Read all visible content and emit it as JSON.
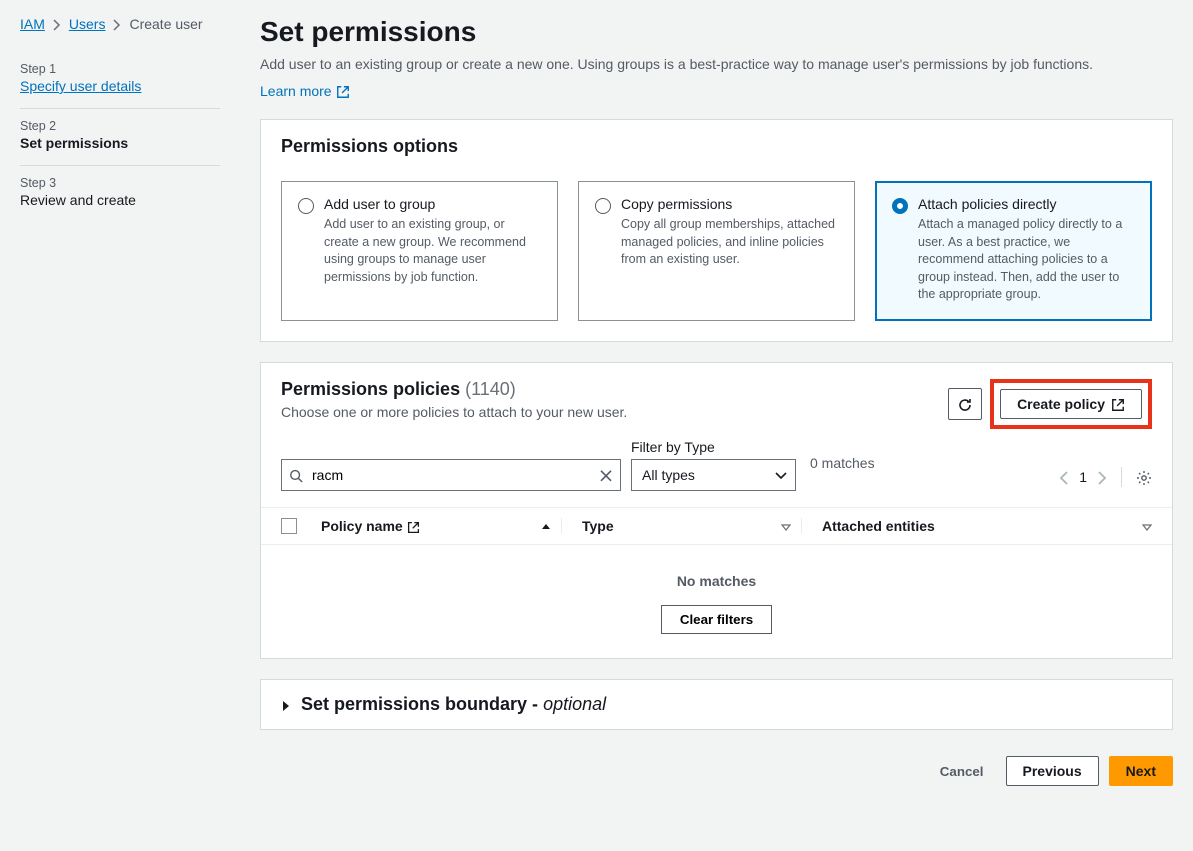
{
  "breadcrumb": {
    "items": [
      "IAM",
      "Users",
      "Create user"
    ]
  },
  "steps": {
    "step1_num": "Step 1",
    "step1_title": "Specify user details",
    "step2_num": "Step 2",
    "step2_title": "Set permissions",
    "step3_num": "Step 3",
    "step3_title": "Review and create"
  },
  "header": {
    "title": "Set permissions",
    "description": "Add user to an existing group or create a new one. Using groups is a best-practice way to manage user's permissions by job functions.",
    "learn_more": "Learn more"
  },
  "options_panel": {
    "title": "Permissions options",
    "option1": {
      "title": "Add user to group",
      "desc": "Add user to an existing group, or create a new group. We recommend using groups to manage user permissions by job function."
    },
    "option2": {
      "title": "Copy permissions",
      "desc": "Copy all group memberships, attached managed policies, and inline policies from an existing user."
    },
    "option3": {
      "title": "Attach policies directly",
      "desc": "Attach a managed policy directly to a user. As a best practice, we recommend attaching policies to a group instead. Then, add the user to the appropriate group."
    }
  },
  "policies_panel": {
    "title": "Permissions policies",
    "count": "(1140)",
    "subtext": "Choose one or more policies to attach to your new user.",
    "create_policy": "Create policy",
    "filter_type_label": "Filter by Type",
    "search_value": "racm",
    "type_filter": "All types",
    "matches": "0 matches",
    "page": "1",
    "col_policy": "Policy name",
    "col_type": "Type",
    "col_attached": "Attached entities",
    "no_matches": "No matches",
    "clear_filters": "Clear filters"
  },
  "boundary": {
    "title": "Set permissions boundary - ",
    "optional": "optional"
  },
  "footer": {
    "cancel": "Cancel",
    "previous": "Previous",
    "next": "Next"
  }
}
